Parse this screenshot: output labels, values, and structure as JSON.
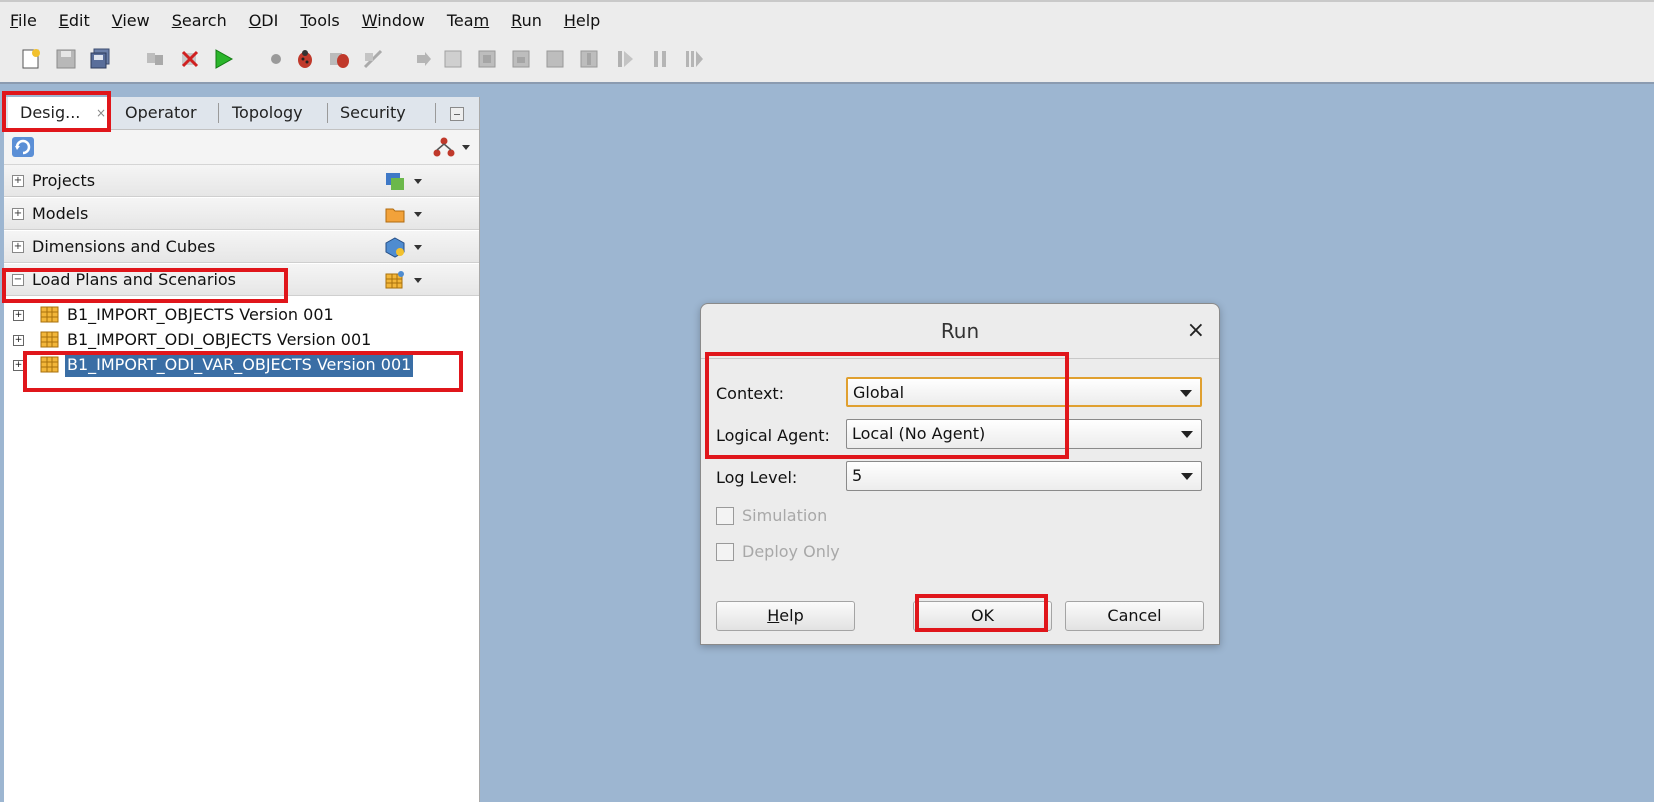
{
  "menu": [
    {
      "pre": "",
      "mn": "F",
      "post": "ile"
    },
    {
      "pre": "",
      "mn": "E",
      "post": "dit"
    },
    {
      "pre": "",
      "mn": "V",
      "post": "iew"
    },
    {
      "pre": "",
      "mn": "S",
      "post": "earch"
    },
    {
      "pre": "",
      "mn": "O",
      "post": "DI"
    },
    {
      "pre": "",
      "mn": "T",
      "post": "ools"
    },
    {
      "pre": "",
      "mn": "W",
      "post": "indow"
    },
    {
      "pre": "Tea",
      "mn": "m",
      "post": ""
    },
    {
      "pre": "",
      "mn": "R",
      "post": "un"
    },
    {
      "pre": "",
      "mn": "H",
      "post": "elp"
    }
  ],
  "tabs": {
    "designer": "Desig...",
    "designer_close": "×",
    "operator": "Operator",
    "topology": "Topology",
    "security": "Security"
  },
  "accordions": {
    "projects": "Projects",
    "models": "Models",
    "dimensions": "Dimensions and Cubes",
    "loadplans": "Load Plans and Scenarios"
  },
  "tree": [
    "B1_IMPORT_OBJECTS Version 001",
    "B1_IMPORT_ODI_OBJECTS Version 001",
    "B1_IMPORT_ODI_VAR_OBJECTS Version 001"
  ],
  "dialog": {
    "title": "Run",
    "close": "×",
    "context_label": "Context:",
    "context_value": "Global",
    "agent_label": "Logical Agent:",
    "agent_value": "Local (No Agent)",
    "loglevel_label": "Log Level:",
    "loglevel_value": "5",
    "simulation_label": "Simulation",
    "deploy_label": "Deploy Only",
    "help_mn": "H",
    "help_rest": "elp",
    "ok_label": "OK",
    "cancel_label": "Cancel"
  },
  "colors": {
    "desktop": "#9db6d1",
    "highlight": "#e0161b",
    "selection": "#3a6ea5"
  },
  "icons": [
    "new-icon",
    "save-icon",
    "save-all-icon",
    "cut-icon",
    "delete-icon",
    "run-icon",
    "stop-icon",
    "debug-icon",
    "debug-session-icon",
    "clear-icon",
    "step-icon",
    "step-into-icon",
    "step-over-icon",
    "step-out-icon",
    "pause-icon",
    "resume-icon"
  ]
}
